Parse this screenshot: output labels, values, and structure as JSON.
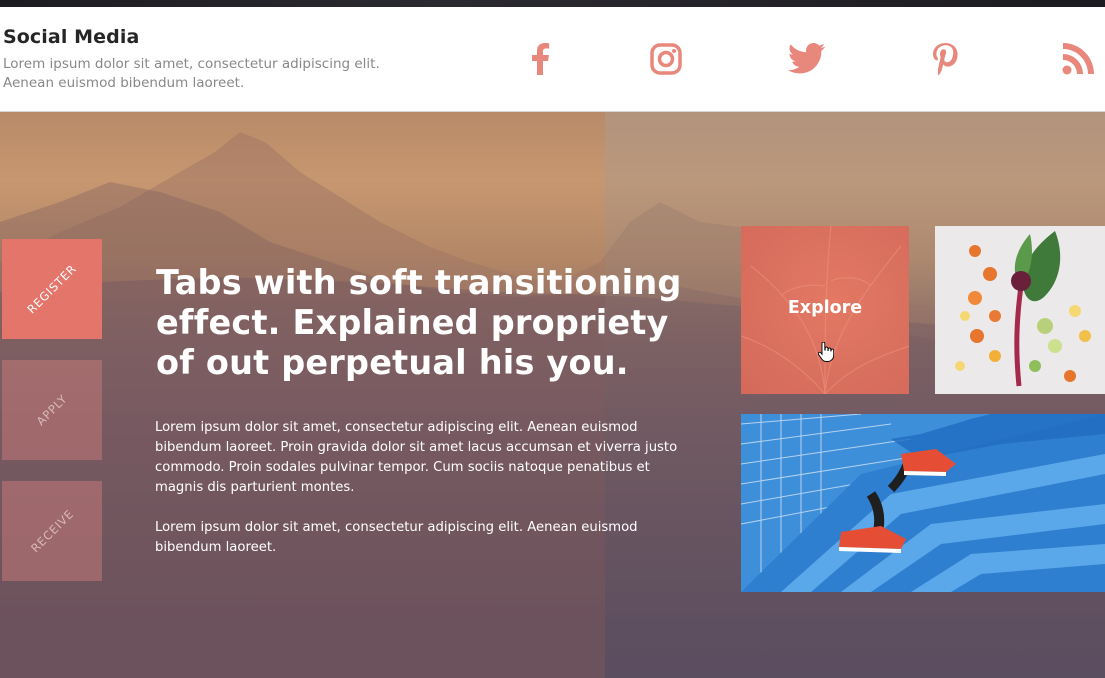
{
  "header": {
    "title": "Social Media",
    "description": "Lorem ipsum dolor sit amet, consectetur adipiscing elit. Aenean euismod bibendum laoreet."
  },
  "social_icons": [
    "facebook-icon",
    "instagram-icon",
    "twitter-icon",
    "pinterest-icon",
    "rss-icon"
  ],
  "tabs": [
    {
      "label": "REGISTER",
      "active": true
    },
    {
      "label": "APPLY",
      "active": false
    },
    {
      "label": "RECEIVE",
      "active": false
    }
  ],
  "hero": {
    "heading": "Tabs with soft transitioning effect. Explained propriety of out perpetual his you.",
    "paragraph_1": "Lorem ipsum dolor sit amet, consectetur adipiscing elit. Aenean euismod bibendum laoreet. Proin gravida dolor sit amet lacus accumsan et viverra justo commodo. Proin sodales pulvinar tempor. Cum sociis natoque penatibus et magnis dis parturient montes.",
    "paragraph_2": "Lorem ipsum dolor sit amet, consectetur adipiscing elit. Aenean euismod bibendum laoreet."
  },
  "tiles": {
    "explore_label": "Explore"
  },
  "colors": {
    "accent": "#e4756b",
    "icon": "#e8877b",
    "header_bg": "#ffffff"
  }
}
